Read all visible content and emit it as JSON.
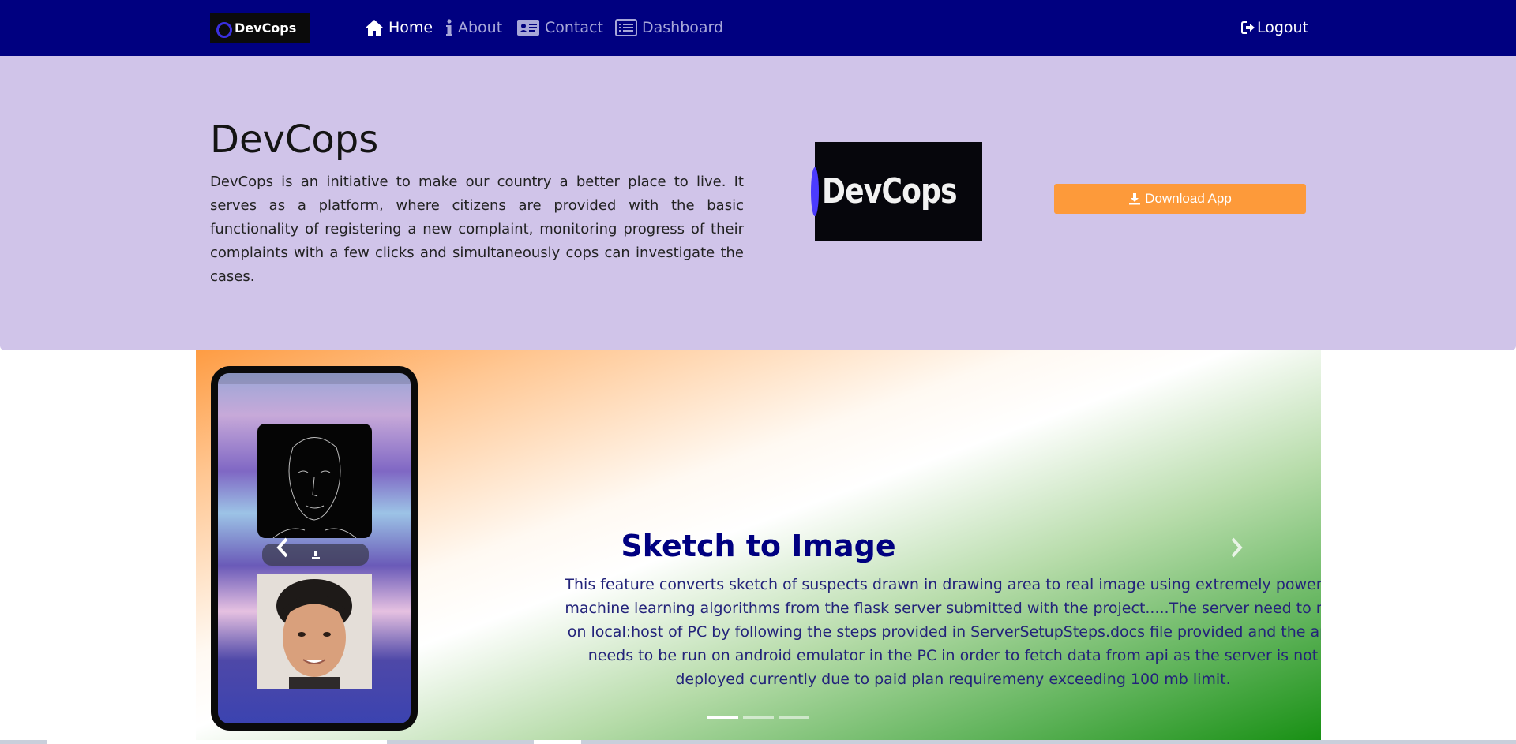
{
  "nav": {
    "brand": "DevCops",
    "items": [
      {
        "label": "Home",
        "icon": "home-icon",
        "active": true
      },
      {
        "label": "About",
        "icon": "info-icon",
        "active": false
      },
      {
        "label": "Contact",
        "icon": "contact-card-icon",
        "active": false
      },
      {
        "label": "Dashboard",
        "icon": "list-alt-icon",
        "active": false
      }
    ],
    "logout": "Logout",
    "logout_icon": "logout-icon"
  },
  "hero": {
    "title": "DevCops",
    "description": "DevCops is an initiative to make our country a better place to live. It serves as a platform, where citizens are provided with the basic functionality of registering a new complaint, monitoring progress of their complaints with a few clicks and simultaneously cops can investigate the cases.",
    "logo_text": "DevCops",
    "download_label": "Download App",
    "download_icon": "download-icon"
  },
  "carousel": {
    "slide_title": "Sketch to Image",
    "slide_text": "This feature converts sketch of suspects drawn in drawing area to real image using extremely powerful machine learning algorithms from the flask server submitted with the project.....The server need to run on local:host of PC by following the steps provided in ServerSetupSteps.docs file provided and the app needs to be run on android emulator in the PC in order to fetch data from api as the server is not deployed currently due to paid plan requiremeny exceeding 100 mb limit.",
    "indicator_count": 3,
    "active_indicator": 0
  },
  "colors": {
    "navbar": "#000080",
    "hero_bg": "#d0c4e9",
    "download_btn": "#fd9a3a",
    "caption_title": "#000080"
  }
}
